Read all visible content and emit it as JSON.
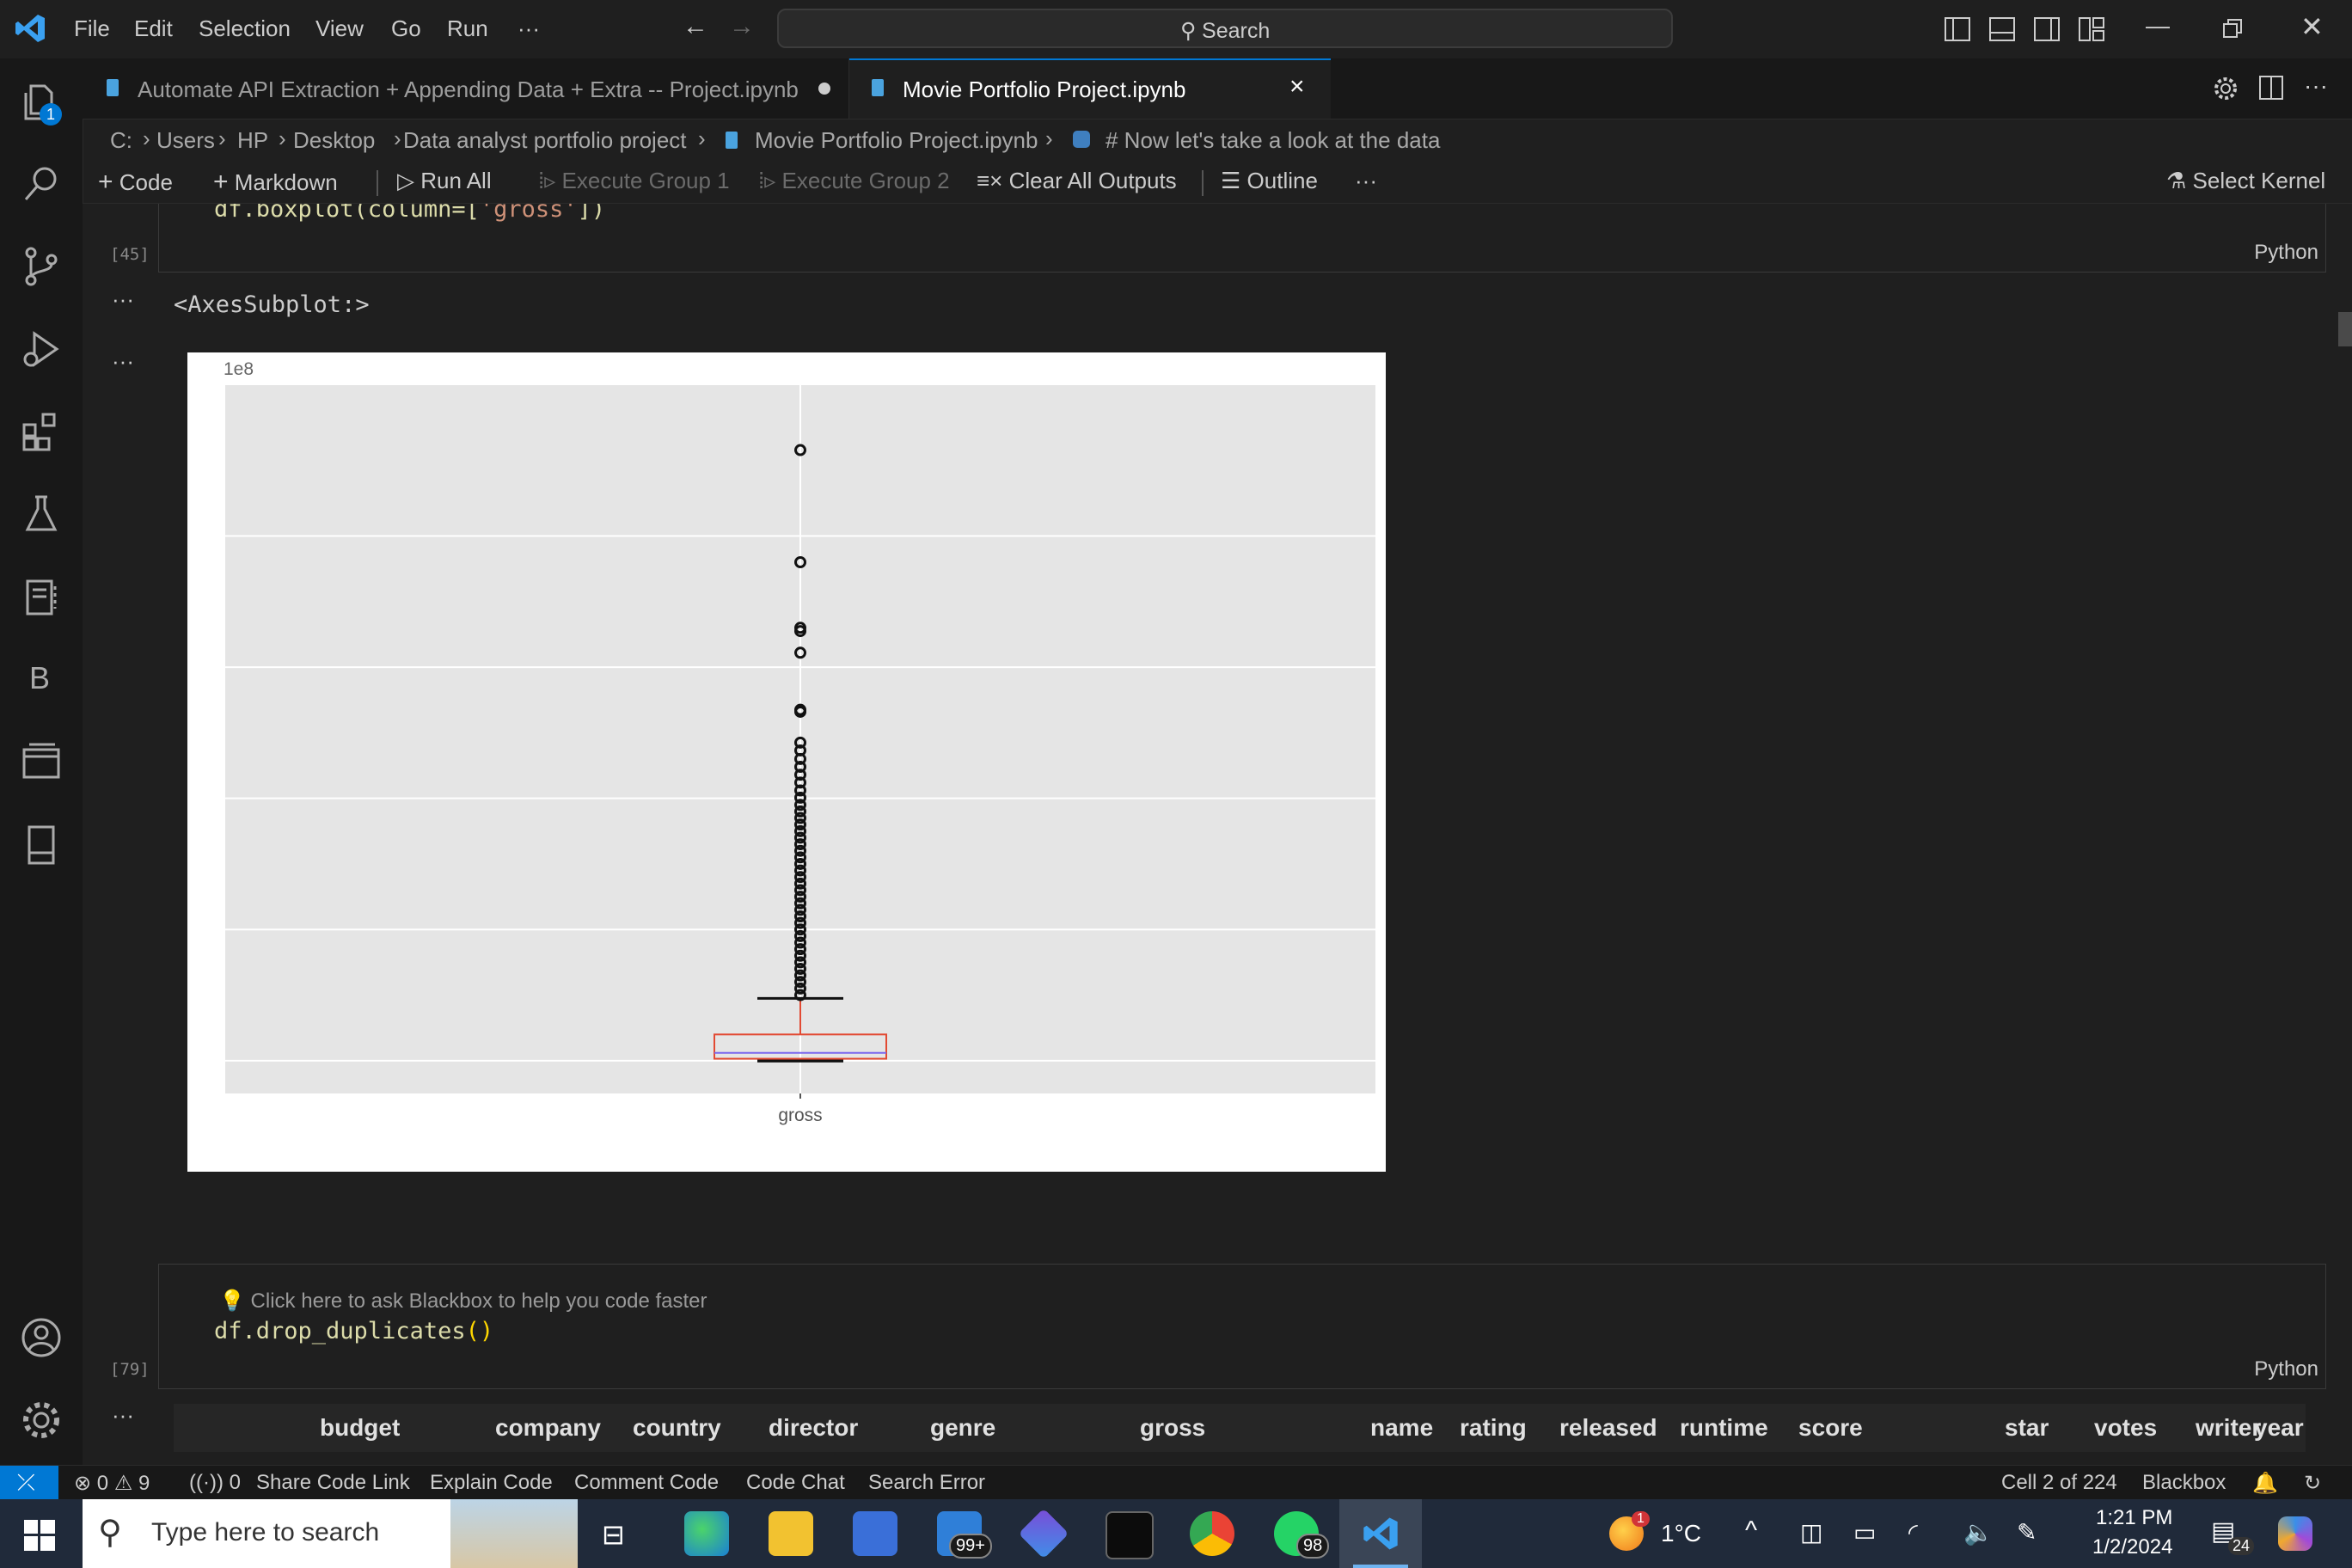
{
  "menu": [
    "File",
    "Edit",
    "Selection",
    "View",
    "Go",
    "Run",
    "···"
  ],
  "search": {
    "label": "Search"
  },
  "activity": {
    "explorer_badge": "1",
    "letter": "B"
  },
  "tabs": [
    {
      "label": "Automate API Extraction + Appending Data + Extra -- Project.ipynb"
    },
    {
      "label": "Movie Portfolio Project.ipynb"
    }
  ],
  "breadcrumb": [
    "C:",
    "Users",
    "HP",
    "Desktop",
    "Data analyst portfolio project",
    "Movie Portfolio Project.ipynb",
    "# Now let's take a look at the data"
  ],
  "toolbar": {
    "code": "Code",
    "markdown": "Markdown",
    "run_all": "Run All",
    "exec_group1": "Execute Group 1",
    "exec_group2": "Execute Group 2",
    "clear_outputs": "Clear All Outputs",
    "outline": "Outline",
    "more": "···",
    "select_kernel": "Select Kernel"
  },
  "cell1": {
    "code_prefix": "df.boxplot(column=[",
    "code_string": "'gross'",
    "code_suffix": "])",
    "exec_count": "[45]",
    "language": "Python",
    "output_text": "<AxesSubplot:>",
    "output_more": "···"
  },
  "cell2": {
    "hint": "💡 Click here to ask Blackbox to help you code faster",
    "code_fn": "df.drop_duplicates",
    "code_parens": "()",
    "exec_count": "[79]",
    "language": "Python",
    "output_more": "···",
    "columns": [
      "budget",
      "company",
      "country",
      "director",
      "genre",
      "gross",
      "name",
      "rating",
      "released",
      "runtime",
      "score",
      "star",
      "votes",
      "writer",
      "year"
    ]
  },
  "chart_data": {
    "type": "boxplot",
    "title": "",
    "offset_label": "1e8",
    "categories": [
      "gross"
    ],
    "ylim": [
      -0.5,
      10.3
    ],
    "yticks": [
      0,
      2,
      4,
      6,
      8
    ],
    "grid": true,
    "box": {
      "whisker_low": 0.0,
      "q1": 0.03,
      "median": 0.12,
      "q3": 0.4,
      "whisker_high": 0.95
    },
    "outliers": [
      9.31,
      7.6,
      6.6,
      6.55,
      6.22,
      5.35,
      5.32,
      4.85,
      4.73,
      4.6,
      4.48,
      4.36,
      4.24,
      4.12,
      4.01,
      3.9,
      3.8,
      3.7,
      3.6,
      3.5,
      3.4,
      3.3,
      3.2,
      3.1,
      3.0,
      2.9,
      2.8,
      2.7,
      2.6,
      2.5,
      2.4,
      2.3,
      2.2,
      2.1,
      2.0,
      1.9,
      1.8,
      1.7,
      1.6,
      1.5,
      1.4,
      1.3,
      1.2,
      1.1,
      1.0
    ]
  },
  "status": {
    "errors": "0",
    "warnings": "9",
    "ports": "0",
    "share": "Share Code Link",
    "explain": "Explain Code",
    "comment": "Comment Code",
    "chat": "Code Chat",
    "search_error": "Search Error",
    "cell": "Cell 2 of 224",
    "blackbox": "Blackbox"
  },
  "taskbar": {
    "search_placeholder": "Type here to search",
    "mail_badge": "99+",
    "whatsapp_badge": "98",
    "weather": "1°C",
    "weather_badge": "1",
    "time": "1:21 PM",
    "date": "1/2/2024",
    "notif": "24"
  },
  "colors": {
    "accent": "#0078d4",
    "box": "#e24a33",
    "median": "#7b68ee"
  }
}
